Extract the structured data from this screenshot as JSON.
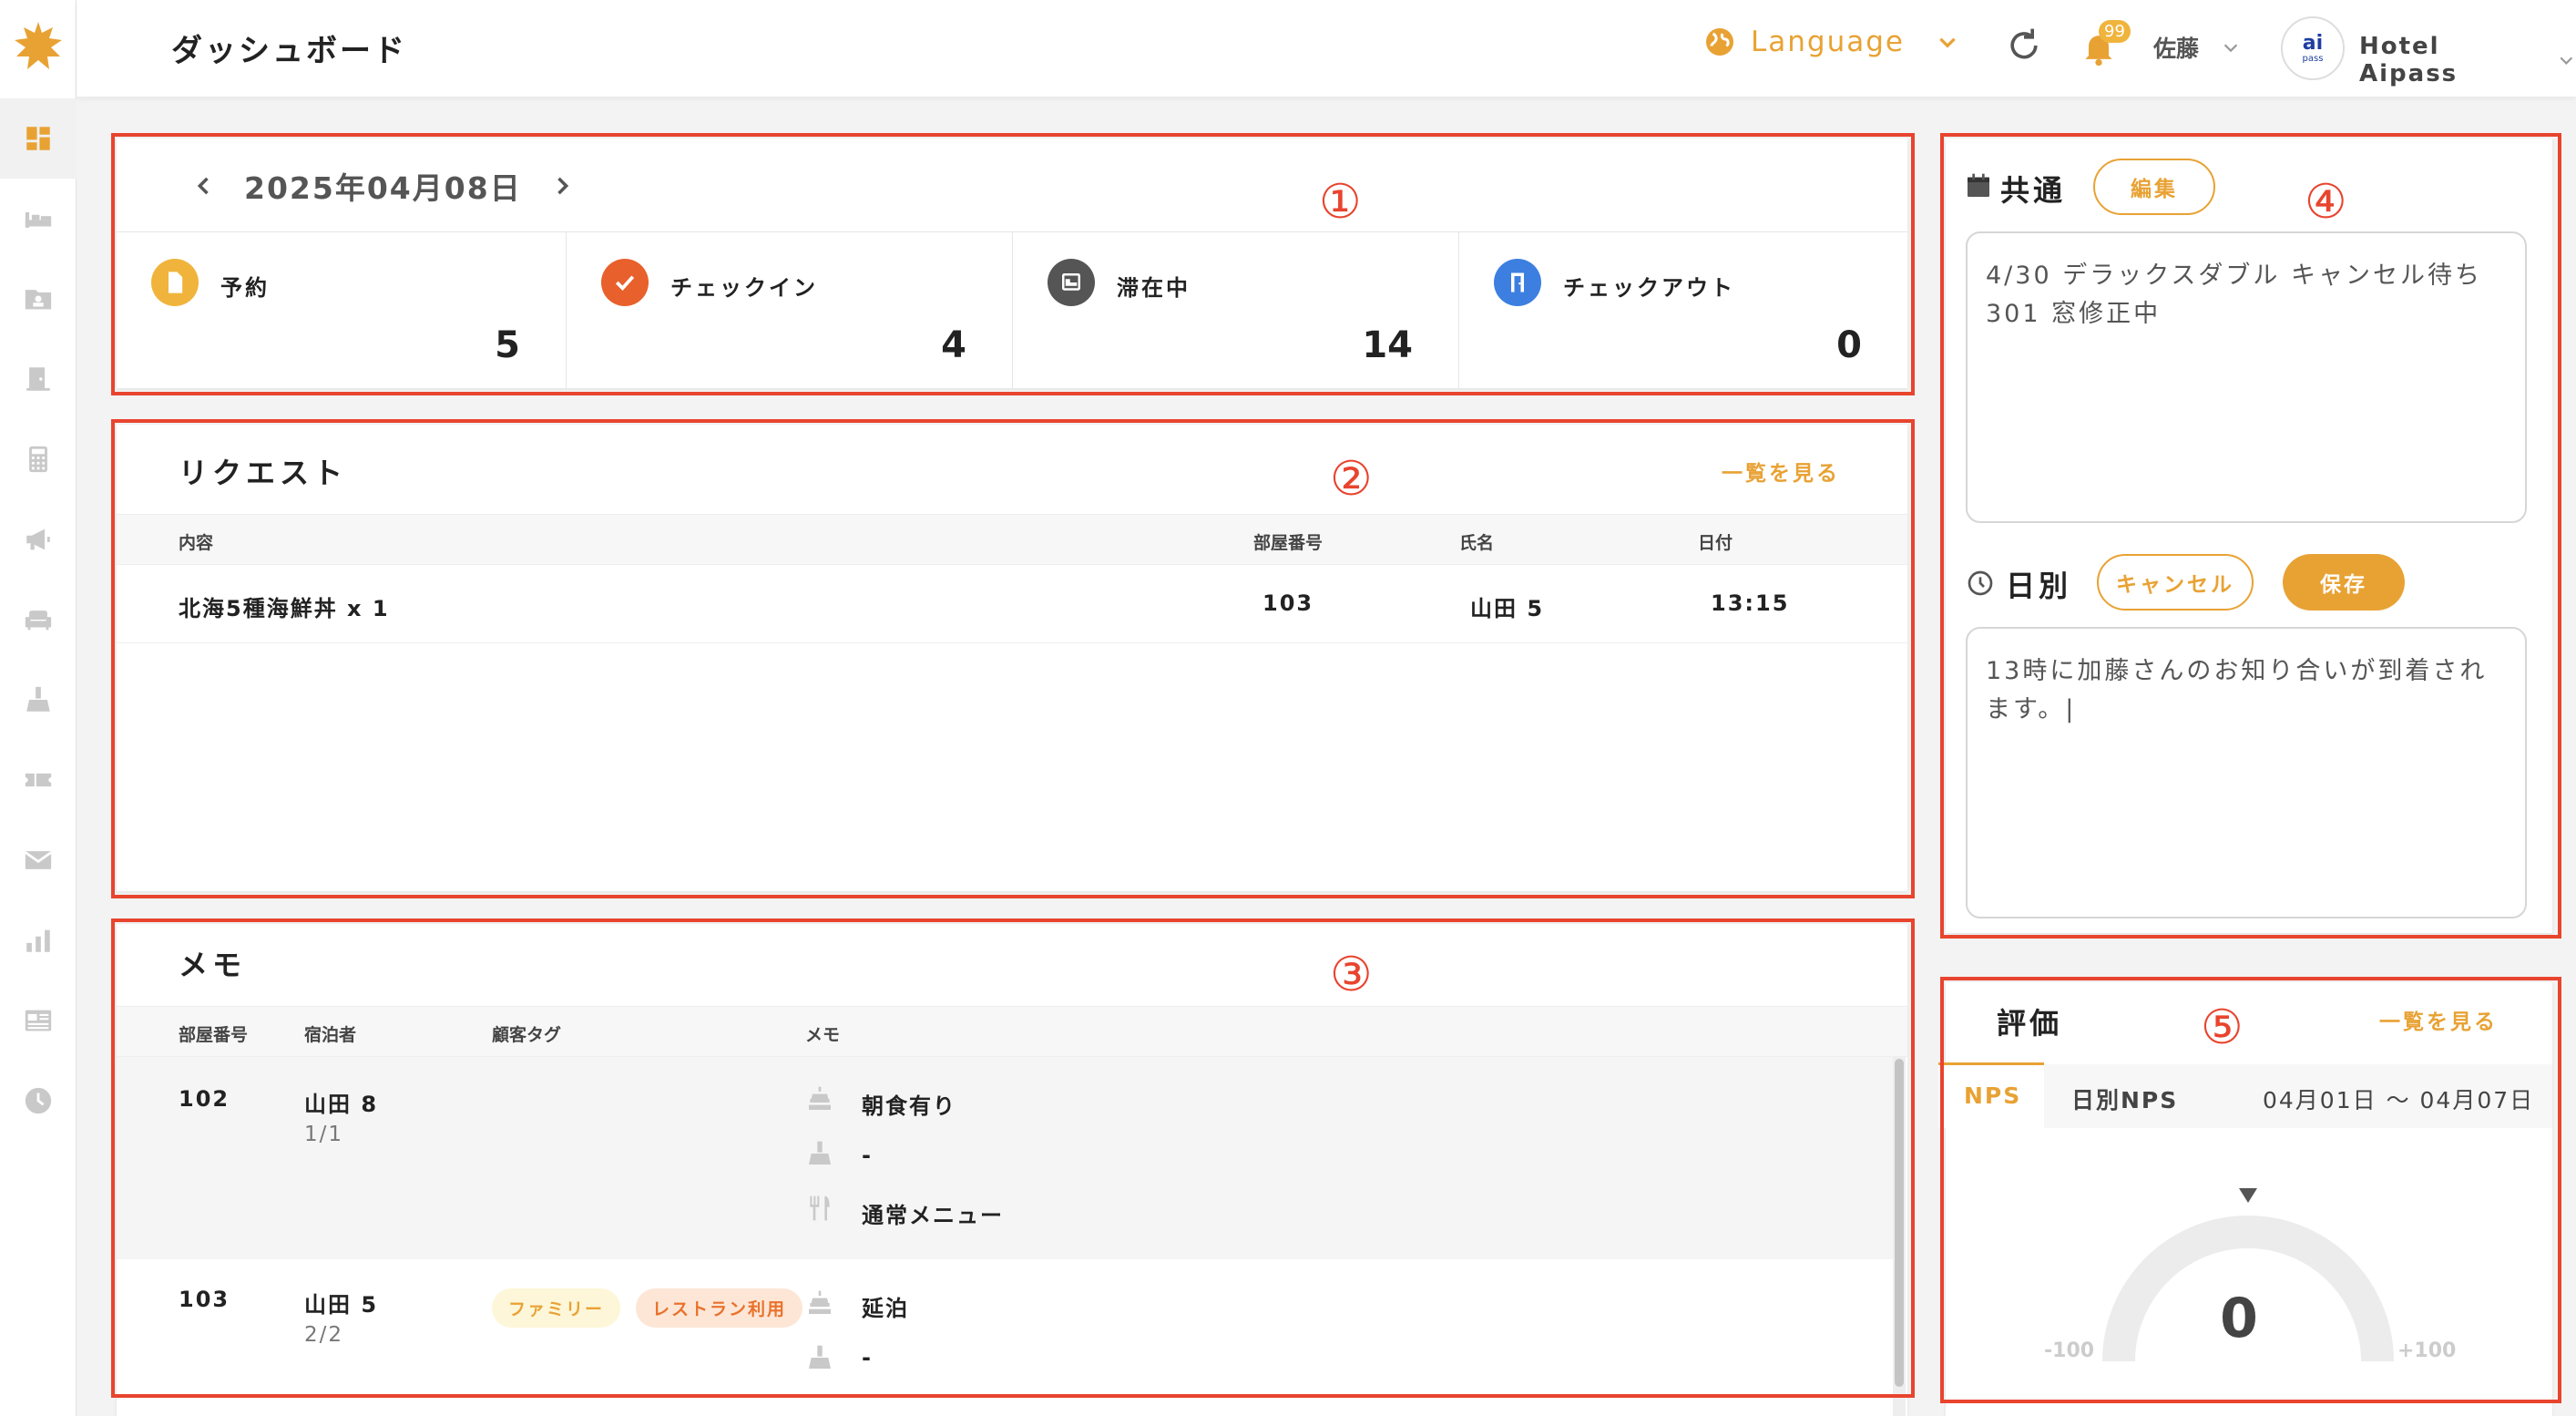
{
  "header": {
    "title": "ダッシュボード",
    "language_label": "Language",
    "notification_count": "99",
    "user_name": "佐藤",
    "hotel_logo_text": "ai",
    "hotel_logo_sub": "pass",
    "hotel_name": "Hotel Aipass"
  },
  "colors": {
    "accent": "#e8a234",
    "annotation": "#e8442e"
  },
  "sidebar": {
    "items": [
      {
        "icon": "dashboard-icon"
      },
      {
        "icon": "bed-icon"
      },
      {
        "icon": "guest-folder-icon"
      },
      {
        "icon": "door-icon"
      },
      {
        "icon": "calculator-icon"
      },
      {
        "icon": "megaphone-icon"
      },
      {
        "icon": "sofa-icon"
      },
      {
        "icon": "cleaning-icon"
      },
      {
        "icon": "ticket-icon"
      },
      {
        "icon": "mail-icon"
      },
      {
        "icon": "bar-chart-icon"
      },
      {
        "icon": "news-icon"
      },
      {
        "icon": "clock-icon"
      }
    ]
  },
  "annotations": [
    "①",
    "②",
    "③",
    "④",
    "⑤"
  ],
  "overview": {
    "date": "2025年04月08日",
    "stats": [
      {
        "label": "予約",
        "value": "5",
        "icon": "document-icon",
        "color": "#f0b43c"
      },
      {
        "label": "チェックイン",
        "value": "4",
        "icon": "check-icon",
        "color": "#e8602c"
      },
      {
        "label": "滞在中",
        "value": "14",
        "icon": "bed-icon",
        "color": "#555555"
      },
      {
        "label": "チェックアウト",
        "value": "0",
        "icon": "exit-door-icon",
        "color": "#3d7fe0"
      }
    ]
  },
  "requests": {
    "title": "リクエスト",
    "view_all": "一覧を見る",
    "columns": [
      "内容",
      "部屋番号",
      "氏名",
      "日付"
    ],
    "rows": [
      {
        "content": "北海5種海鮮丼 x 1",
        "room": "103",
        "name": "山田 5",
        "date": "13:15"
      }
    ]
  },
  "memo": {
    "title": "メモ",
    "columns": [
      "部屋番号",
      "宿泊者",
      "顧客タグ",
      "メモ"
    ],
    "rows": [
      {
        "room": "102",
        "guest": "山田 8",
        "count": "1/1",
        "tags": [],
        "memos": [
          {
            "icon": "breakfast-icon",
            "text": "朝食有り"
          },
          {
            "icon": "cleaning-icon",
            "text": "-"
          },
          {
            "icon": "restaurant-icon",
            "text": "通常メニュー"
          }
        ]
      },
      {
        "room": "103",
        "guest": "山田 5",
        "count": "2/2",
        "tags": [
          "ファミリー",
          "レストラン利用"
        ],
        "memos": [
          {
            "icon": "breakfast-icon",
            "text": "延泊"
          },
          {
            "icon": "cleaning-icon",
            "text": "-"
          }
        ]
      }
    ]
  },
  "notes": {
    "common_title": "共通",
    "edit_label": "編集",
    "common_text": "4/30 デラックスダブル キャンセル待ち\n301 窓修正中",
    "daily_title": "日別",
    "cancel_label": "キャンセル",
    "save_label": "保存",
    "daily_text": "13時に加藤さんのお知り合いが到着されます。|"
  },
  "ratings": {
    "title": "評価",
    "view_all": "一覧を見る",
    "tabs": [
      "NPS",
      "日別NPS"
    ],
    "date_range": "04月01日 〜 04月07日",
    "gauge_value": "0",
    "gauge_min": "-100",
    "gauge_max": "+100"
  }
}
